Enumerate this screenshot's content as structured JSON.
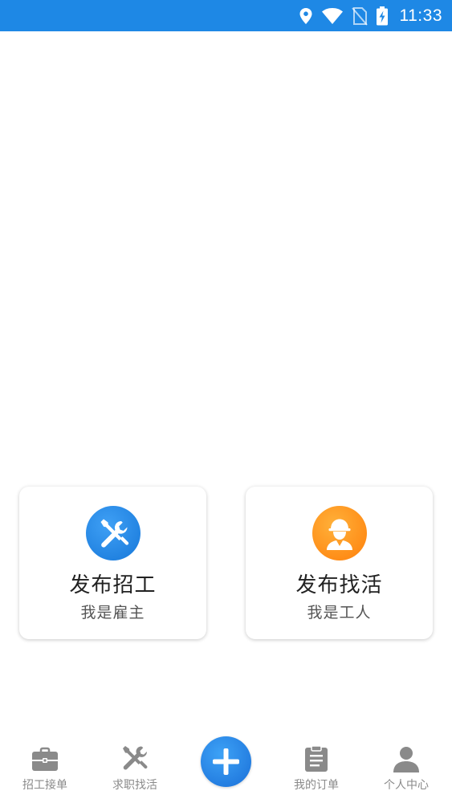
{
  "status_bar": {
    "time": "11:33",
    "icons": [
      "location-icon",
      "wifi-icon",
      "no-sim-icon",
      "battery-charging-icon"
    ],
    "background_color": "#1e88e5"
  },
  "cards": [
    {
      "icon": "tools-icon",
      "icon_color": "#1e88e5",
      "title": "发布招工",
      "subtitle": "我是雇主"
    },
    {
      "icon": "worker-helmet-icon",
      "icon_color": "#ff8c1a",
      "title": "发布找活",
      "subtitle": "我是工人"
    }
  ],
  "bottom_nav": {
    "items": [
      {
        "icon": "briefcase-icon",
        "label": "招工接单"
      },
      {
        "icon": "tools-icon",
        "label": "求职找活"
      },
      {
        "icon": "plus-icon",
        "label": ""
      },
      {
        "icon": "clipboard-icon",
        "label": "我的订单"
      },
      {
        "icon": "person-icon",
        "label": "个人中心"
      }
    ],
    "label_color": "#8a8a8a",
    "add_button_color": "#1e88e5"
  }
}
